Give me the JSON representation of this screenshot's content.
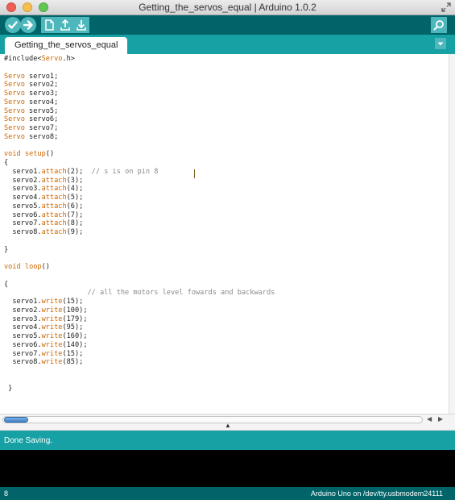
{
  "window": {
    "title": "Getting_the_servos_equal | Arduino 1.0.2"
  },
  "toolbar": {
    "buttons": [
      {
        "icon": "verify-icon"
      },
      {
        "icon": "upload-icon"
      },
      {
        "icon": "new-icon"
      },
      {
        "icon": "open-icon"
      },
      {
        "icon": "save-icon"
      },
      {
        "icon": "serial-monitor-icon"
      }
    ],
    "accent": "#006468",
    "button_color": "#4db7bb"
  },
  "tabs": [
    {
      "label": "Getting_the_servos_equal",
      "active": true
    }
  ],
  "editor": {
    "lines": [
      "#include<Servo.h>",
      "",
      "Servo servo1;",
      "Servo servo2;",
      "Servo servo3;",
      "Servo servo4;",
      "Servo servo5;",
      "Servo servo6;",
      "Servo servo7;",
      "Servo servo8;",
      "",
      "void setup()",
      "{",
      "  servo1.attach(2);  // s is on pin 8",
      "  servo2.attach(3);",
      "  servo3.attach(4);",
      "  servo4.attach(5);",
      "  servo5.attach(6);",
      "  servo6.attach(7);",
      "  servo7.attach(8);",
      "  servo8.attach(9);",
      "",
      "}",
      "",
      "void loop()",
      "",
      "{",
      "                    // all the motors level fowards and backwards",
      "  servo1.write(15);",
      "  servo2.write(100);",
      "  servo3.write(179);",
      "  servo4.write(95);",
      "  servo5.write(160);",
      "  servo6.write(140);",
      "  servo7.write(15);",
      "  servo8.write(85);",
      "",
      "",
      " }"
    ],
    "keyword_color": "#cc6600",
    "comment_color": "#8a8a8a"
  },
  "status": {
    "message": "Done Saving."
  },
  "footer": {
    "line_number": "8",
    "board": "Arduino Uno on /dev/tty.usbmodem24111"
  },
  "colors": {
    "teal": "#17a1a5",
    "dark_teal": "#006468"
  }
}
